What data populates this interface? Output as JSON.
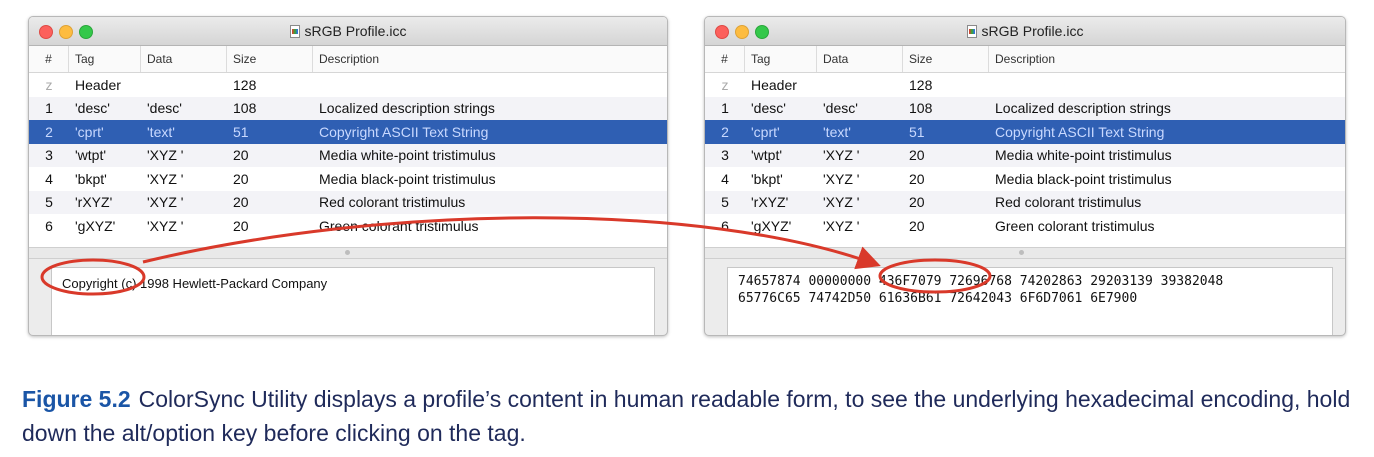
{
  "colors": {
    "selection": "#2f5fb3",
    "annotation": "#d9392a",
    "figure_label": "#1a55a6",
    "caption_text": "#1f2a5a"
  },
  "windows": [
    {
      "title": "sRGB Profile.icc",
      "columns": [
        "#",
        "Tag",
        "Data",
        "Size",
        "Description"
      ],
      "rows": [
        {
          "num": "z",
          "tag": "Header",
          "data": "",
          "size": "128",
          "desc": ""
        },
        {
          "num": "1",
          "tag": "'desc'",
          "data": "'desc'",
          "size": "108",
          "desc": "Localized description strings"
        },
        {
          "num": "2",
          "tag": "'cprt'",
          "data": "'text'",
          "size": "51",
          "desc": "Copyright ASCII Text String"
        },
        {
          "num": "3",
          "tag": "'wtpt'",
          "data": "'XYZ '",
          "size": "20",
          "desc": "Media white-point tristimulus"
        },
        {
          "num": "4",
          "tag": "'bkpt'",
          "data": "'XYZ '",
          "size": "20",
          "desc": "Media black-point tristimulus"
        },
        {
          "num": "5",
          "tag": "'rXYZ'",
          "data": "'XYZ '",
          "size": "20",
          "desc": "Red colorant tristimulus"
        },
        {
          "num": "6",
          "tag": "'gXYZ'",
          "data": "'XYZ '",
          "size": "20",
          "desc": "Green colorant tristimulus"
        }
      ],
      "detail": "Copyright (c) 1998 Hewlett-Packard Company"
    },
    {
      "title": "sRGB Profile.icc",
      "columns": [
        "#",
        "Tag",
        "Data",
        "Size",
        "Description"
      ],
      "rows": [
        {
          "num": "z",
          "tag": "Header",
          "data": "",
          "size": "128",
          "desc": ""
        },
        {
          "num": "1",
          "tag": "'desc'",
          "data": "'desc'",
          "size": "108",
          "desc": "Localized description strings"
        },
        {
          "num": "2",
          "tag": "'cprt'",
          "data": "'text'",
          "size": "51",
          "desc": "Copyright ASCII Text String"
        },
        {
          "num": "3",
          "tag": "'wtpt'",
          "data": "'XYZ '",
          "size": "20",
          "desc": "Media white-point tristimulus"
        },
        {
          "num": "4",
          "tag": "'bkpt'",
          "data": "'XYZ '",
          "size": "20",
          "desc": "Media black-point tristimulus"
        },
        {
          "num": "5",
          "tag": "'rXYZ'",
          "data": "'XYZ '",
          "size": "20",
          "desc": "Red colorant tristimulus"
        },
        {
          "num": "6",
          "tag": "'gXYZ'",
          "data": "'XYZ '",
          "size": "20",
          "desc": "Green colorant tristimulus"
        }
      ],
      "hex_line1": "74657874 00000000 436F7079 72696768 74202863 29203139 39382048",
      "hex_line2": "65776C65 74742D50 61636B61 72642043 6F6D7061 6E7900"
    }
  ],
  "caption": {
    "figure_label": "Figure 5.2",
    "text": "ColorSync Utility displays a profile’s content in human readable form, to see the underlying hexadecimal encoding, hold down the alt/option key before clicking on the tag."
  }
}
